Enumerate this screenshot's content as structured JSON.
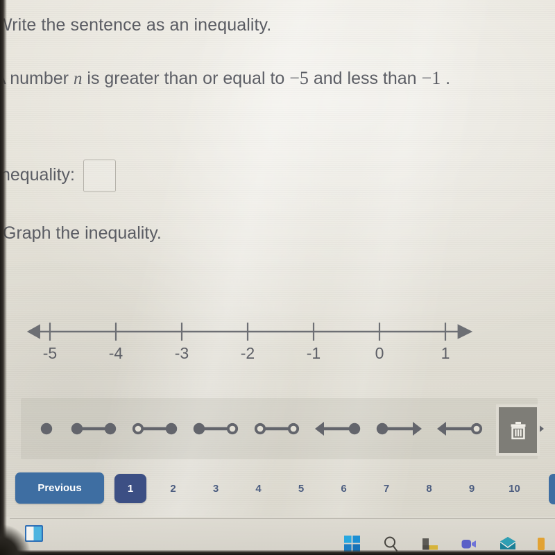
{
  "question": {
    "prompt": "Write the sentence as an inequality.",
    "sentence_pre": "A number ",
    "sentence_var": "n",
    "sentence_mid": " is greater than or equal to ",
    "sentence_num1": "−5",
    "sentence_mid2": " and less than ",
    "sentence_num2": "−1",
    "sentence_end": " ."
  },
  "answer": {
    "label": "Inequality:",
    "value": "",
    "placeholder": ""
  },
  "graph": {
    "instruction": "Graph the inequality."
  },
  "chart_data": {
    "type": "numberline",
    "title": "Graph the inequality.",
    "tick_labels": [
      "-5",
      "-4",
      "-3",
      "-2",
      "-1",
      "0",
      "1"
    ],
    "tick_values": [
      -5,
      -4,
      -3,
      -2,
      -1,
      0,
      1
    ],
    "xlim": [
      -5.25,
      1.25
    ],
    "left_arrow": true,
    "right_arrow": true,
    "plotted_points": [],
    "grid": false,
    "axis_color": "#6d6f74"
  },
  "toolbar": {
    "tools": [
      {
        "name": "closed-point-tool",
        "type": "point",
        "left_end": "closed",
        "right_end": "none",
        "arrow": "none"
      },
      {
        "name": "closed-closed-segment-tool",
        "type": "segment",
        "left_end": "closed",
        "right_end": "closed",
        "arrow": "none"
      },
      {
        "name": "open-closed-segment-tool",
        "type": "segment",
        "left_end": "open",
        "right_end": "closed",
        "arrow": "none"
      },
      {
        "name": "closed-open-segment-tool",
        "type": "segment",
        "left_end": "closed",
        "right_end": "open",
        "arrow": "none"
      },
      {
        "name": "open-open-segment-tool",
        "type": "segment",
        "left_end": "open",
        "right_end": "open",
        "arrow": "none"
      },
      {
        "name": "left-ray-closed-tool",
        "type": "ray",
        "left_end": "arrow",
        "right_end": "closed",
        "arrow": "left"
      },
      {
        "name": "right-ray-closed-tool",
        "type": "ray",
        "left_end": "closed",
        "right_end": "arrow",
        "arrow": "right"
      },
      {
        "name": "left-ray-open-tool",
        "type": "ray",
        "left_end": "arrow",
        "right_end": "open",
        "arrow": "left"
      },
      {
        "name": "right-ray-open-tool",
        "type": "ray",
        "left_end": "open",
        "right_end": "arrow",
        "arrow": "right"
      }
    ],
    "delete_label": "",
    "delete_icon": "trash-icon",
    "tool_color": "#63656c"
  },
  "pagination": {
    "previous_label": "Previous",
    "pages": [
      "1",
      "2",
      "3",
      "4",
      "5",
      "6",
      "7",
      "8",
      "9",
      "10"
    ],
    "active_page": "1",
    "active_color": "#3c4f84",
    "previous_color": "#3e6ea2"
  },
  "taskbar": {
    "tab_icon": "browser-tab-icon",
    "items": [
      {
        "name": "windows-start-icon"
      },
      {
        "name": "search-icon"
      },
      {
        "name": "file-explorer-icon"
      },
      {
        "name": "video-call-icon"
      },
      {
        "name": "mail-icon"
      },
      {
        "name": "app-icon-orange"
      }
    ]
  }
}
